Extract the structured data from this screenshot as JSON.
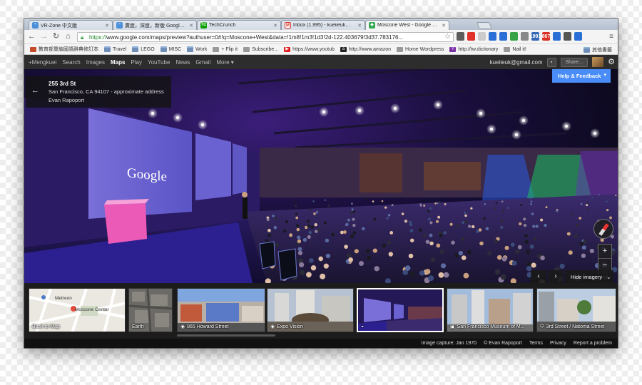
{
  "tabs": [
    {
      "title": "VR-Zone 中文版",
      "favicon_color": "#4a90d9"
    },
    {
      "title": "廣度，深度，新版 Google 地圖",
      "favicon_color": "#4a90d9"
    },
    {
      "title": "TechCrunch",
      "favicon_color": "#0a9e01"
    },
    {
      "title": "Inbox (1,995) - kueiieuk@gmail.com",
      "favicon_color": "#d93025"
    },
    {
      "title": "Moscone West - Google Maps",
      "favicon_color": "#34a853"
    }
  ],
  "omnibox": {
    "scheme": "https://",
    "url_rest": "www.google.com/maps/preview?authuser=0#!q=Moscone+West&data=!1m8!1m3!1d3!2d-122.403679!3d37.783176..."
  },
  "extensions": [
    {
      "label": "",
      "color": "#5b5b5b"
    },
    {
      "label": "",
      "color": "#e0312b"
    },
    {
      "label": "",
      "color": "#cccccc"
    },
    {
      "label": "",
      "color": "#2a6fd6"
    },
    {
      "label": "",
      "color": "#2a6fd6"
    },
    {
      "label": "",
      "color": "#36a347"
    },
    {
      "label": "",
      "color": "#888888"
    },
    {
      "label": "1991",
      "color": "#3468b5"
    },
    {
      "label": "807",
      "color": "#d93025"
    },
    {
      "label": "",
      "color": "#2a6fd6"
    },
    {
      "label": "",
      "color": "#555555"
    },
    {
      "label": "",
      "color": "#2a6fd6"
    }
  ],
  "bookmarks": [
    {
      "label": "教育部重編國語辭典修訂本",
      "icon_color": "#c64b2b",
      "folder": false
    },
    {
      "label": "Travel",
      "icon_color": "#6f8fb8",
      "folder": true
    },
    {
      "label": "LEGO",
      "icon_color": "#6f8fb8",
      "folder": true
    },
    {
      "label": "MISC",
      "icon_color": "#6f8fb8",
      "folder": true
    },
    {
      "label": "Work",
      "icon_color": "#6f8fb8",
      "folder": true
    },
    {
      "label": "+ Flip it",
      "icon_color": "#999999",
      "folder": false
    },
    {
      "label": "Subscribe...",
      "icon_color": "#999999",
      "folder": false
    },
    {
      "label": "https://www.youtub",
      "icon_color": "#e02020",
      "folder": false
    },
    {
      "label": "http://www.amazon",
      "icon_color": "#222222",
      "folder": false
    },
    {
      "label": "Home Wordpress",
      "icon_color": "#999999",
      "folder": false
    },
    {
      "label": "http://tw.dictionary",
      "icon_color": "#7b2fa6",
      "folder": false
    },
    {
      "label": "Nail it!",
      "icon_color": "#999999",
      "folder": false
    }
  ],
  "bookmarks_other": "其他書籤",
  "gbar": {
    "items": [
      "+Mengkuei",
      "Search",
      "Images",
      "Maps",
      "Play",
      "YouTube",
      "News",
      "Gmail",
      "More ▾"
    ],
    "selected": "Maps",
    "user": "kueiieuk@gmail.com",
    "share_label": "Share..."
  },
  "address_card": {
    "title": "255 3rd St",
    "subtitle": "San Francisco, CA 94107 - approximate address",
    "author": "Evan Rapoport"
  },
  "pano": {
    "screen_text": "Google",
    "help_label": "Help & Feedback",
    "hide_imagery_label": "Hide imagery"
  },
  "thumbnails": [
    {
      "label": "Back to Map",
      "icon": ""
    },
    {
      "label": "Earth",
      "icon": ""
    },
    {
      "label": "865 Howard Street",
      "icon": "camera-icon"
    },
    {
      "label": "Expo Vision",
      "icon": "camera-icon"
    },
    {
      "label": "",
      "icon": "photosphere-icon"
    },
    {
      "label": "San Francisco Museum of M...",
      "icon": "image-icon"
    },
    {
      "label": "3rd Street / Natoma Street",
      "icon": "streetview-icon"
    }
  ],
  "map_thumb": {
    "label1": "Metreon",
    "label2": "Moscone Center"
  },
  "footer": {
    "capture": "Image capture: Jan 1970",
    "copyright": "© Evan Rapoport",
    "links": [
      "Terms",
      "Privacy",
      "Report a problem"
    ]
  }
}
